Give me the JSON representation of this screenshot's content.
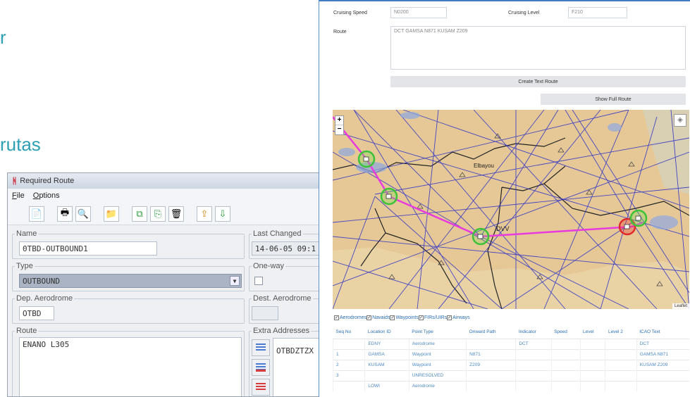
{
  "slide": {
    "frag1": "r",
    "frag2": "rutas"
  },
  "window": {
    "title": "Required Route",
    "menu": [
      "File",
      "Options"
    ],
    "name_label": "Name",
    "name_value": "0TBD-OUTBOUND1",
    "last_changed_label": "Last Changed",
    "last_changed_value": "14-06-05 09:1",
    "type_label": "Type",
    "type_value": "OUTBOUND",
    "oneway_label": "One-way",
    "dep_label": "Dep. Aerodrome",
    "dep_value": "OTBD",
    "dest_label": "Dest. Aerodrome",
    "route_label": "Route",
    "route_value": "ENANO L305",
    "extra_label": "Extra Addresses",
    "extra_value": "OTBDZTZX",
    "toolbar_icons": [
      "new-doc-icon",
      "print-icon",
      "print-preview-icon",
      "open-folder-icon",
      "copy-icon",
      "paste-icon",
      "delete-icon",
      "export-icon",
      "import-icon"
    ]
  },
  "web": {
    "cruise_speed_label": "Cruising Speed",
    "cruise_speed_value": "N0200",
    "cruise_level_label": "Cruising Level",
    "cruise_level_value": "F210",
    "route_label": "Route",
    "route_value": "DCT GAMSA N871 KUSAM Z209",
    "create_btn": "Create Text Route",
    "full_btn": "Show Full Route",
    "map": {
      "zoom_in": "+",
      "zoom_out": "−",
      "attribution": "Leaflet",
      "place_label": "Elbayou",
      "wp_label": "DVV"
    },
    "layers": [
      "Aerodromes",
      "Navaids",
      "Waypoints",
      "FIRs/UIRs",
      "Airways"
    ],
    "table": {
      "headers": [
        "Seq No",
        "Location ID",
        "Point Type",
        "Onward Path",
        "Indicator",
        "Speed",
        "Level",
        "Level 2",
        "ICAO Text"
      ],
      "rows": [
        [
          "",
          "EDNY",
          "Aerodrome",
          "",
          "DCT",
          "",
          "",
          "",
          "DCT"
        ],
        [
          "1",
          "GAMSA",
          "Waypoint",
          "N871",
          "",
          "",
          "",
          "",
          "GAMSA N871"
        ],
        [
          "2",
          "KUSAM",
          "Waypoint",
          "Z209",
          "",
          "",
          "",
          "",
          "KUSAM Z209"
        ],
        [
          "3",
          "",
          "UNRESOLVED",
          "",
          "",
          "",
          "",
          "",
          ""
        ],
        [
          "",
          "LOWI",
          "Aerodrome",
          "",
          "",
          "",
          "",
          "",
          ""
        ]
      ]
    }
  },
  "colors": {
    "accent": "#2fa0b4",
    "route_line": "#e73adf",
    "airway": "#2a2fc9",
    "land": "#e6c896"
  }
}
